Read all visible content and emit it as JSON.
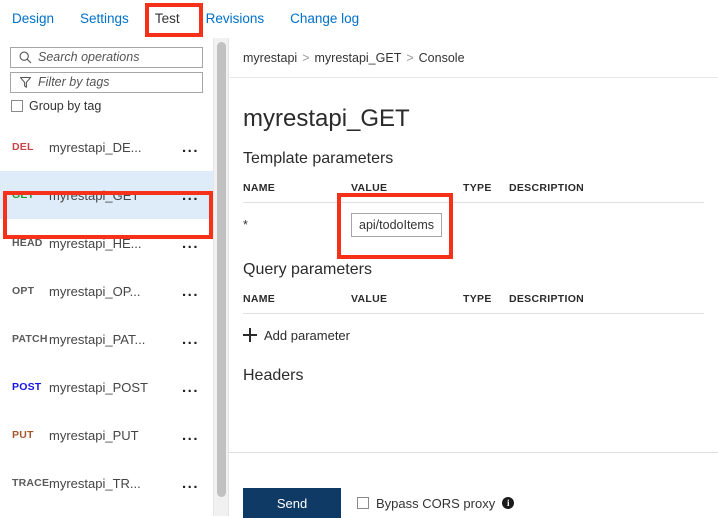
{
  "tabs": [
    {
      "label": "Design",
      "active": false
    },
    {
      "label": "Settings",
      "active": false
    },
    {
      "label": "Test",
      "active": true
    },
    {
      "label": "Revisions",
      "active": false
    },
    {
      "label": "Change log",
      "active": false
    }
  ],
  "sidebar": {
    "search": {
      "placeholder": "Search operations",
      "value": "",
      "icon": "search-icon"
    },
    "filter": {
      "placeholder": "Filter by tags",
      "value": "",
      "icon": "funnel-icon"
    },
    "group_by_tag": {
      "label": "Group by tag",
      "checked": false
    },
    "operations": [
      {
        "method": "DEL",
        "name": "myrestapi_DE...",
        "color": "#c9444a",
        "selected": false
      },
      {
        "method": "GET",
        "name": "myrestapi_GET",
        "color": "#1f9d2e",
        "selected": true
      },
      {
        "method": "HEAD",
        "name": "myrestapi_HE...",
        "color": "#5a5a5a",
        "selected": false
      },
      {
        "method": "OPT",
        "name": "myrestapi_OP...",
        "color": "#5a5a5a",
        "selected": false
      },
      {
        "method": "PATCH",
        "name": "myrestapi_PAT...",
        "color": "#5a5a5a",
        "selected": false
      },
      {
        "method": "POST",
        "name": "myrestapi_POST",
        "color": "#1414e6",
        "selected": false
      },
      {
        "method": "PUT",
        "name": "myrestapi_PUT",
        "color": "#a5562a",
        "selected": false
      },
      {
        "method": "TRACE",
        "name": "myrestapi_TR...",
        "color": "#5a5a5a",
        "selected": false
      }
    ],
    "row_menu_label": "..."
  },
  "main": {
    "breadcrumb": [
      "myrestapi",
      "myrestapi_GET",
      "Console"
    ],
    "breadcrumb_separator": ">",
    "page_title": "myrestapi_GET",
    "template_parameters": {
      "title": "Template parameters",
      "columns": [
        "NAME",
        "VALUE",
        "TYPE",
        "DESCRIPTION"
      ],
      "rows": [
        {
          "name": "*",
          "value": "api/todoItems",
          "type": "",
          "description": ""
        }
      ]
    },
    "query_parameters": {
      "title": "Query parameters",
      "columns": [
        "NAME",
        "VALUE",
        "TYPE",
        "DESCRIPTION"
      ],
      "rows": [],
      "add_label": "Add parameter",
      "add_icon": "plus-icon"
    },
    "headers": {
      "title": "Headers"
    }
  },
  "footer": {
    "send_label": "Send",
    "bypass_cors": {
      "label": "Bypass CORS proxy",
      "checked": false
    },
    "info_icon": "info-icon",
    "info_glyph": "i"
  },
  "colors": {
    "link": "#0070c9",
    "annotation": "#f5311a",
    "selected_row": "#deecf9",
    "send_button": "#0f3a66"
  }
}
